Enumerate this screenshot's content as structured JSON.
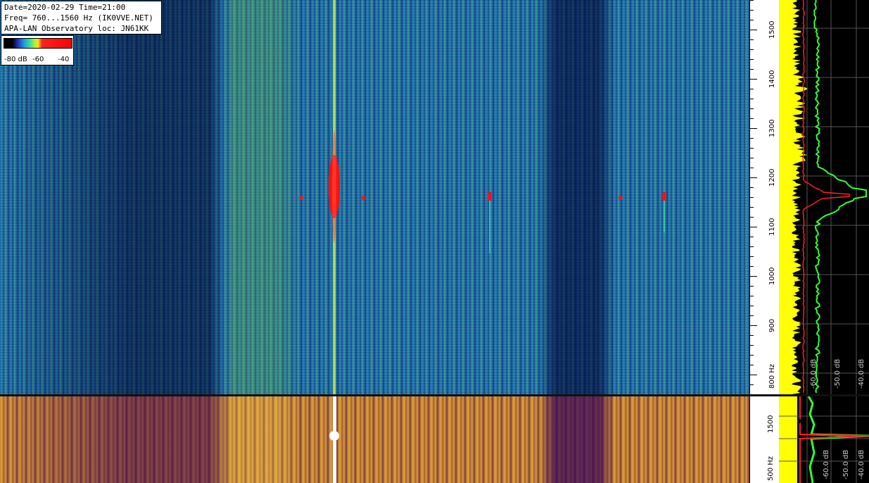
{
  "header": {
    "date_line": "Date=2020-02-29 Time=21:00",
    "freq_line": "Freq= 760...1560 Hz (IK0VVE.NET)",
    "observatory_line": "APA-LAN Observatory loc: JN61KK"
  },
  "legend": {
    "ticks": [
      "-80 dB",
      "-60",
      "-40"
    ]
  },
  "frequency_axis_top": {
    "ticks": [
      {
        "label": "1500",
        "value": 1500
      },
      {
        "label": "1400",
        "value": 1400
      },
      {
        "label": "1300",
        "value": 1300
      },
      {
        "label": "1200",
        "value": 1200
      },
      {
        "label": "1100",
        "value": 1100
      },
      {
        "label": "1000",
        "value": 1000
      },
      {
        "label": "900",
        "value": 900
      },
      {
        "label": "800 Hz",
        "value": 800
      }
    ],
    "min": 760,
    "max": 1560
  },
  "frequency_axis_bottom": {
    "ticks": [
      {
        "label": "1500",
        "value": 1500
      },
      {
        "label": "500 Hz",
        "value": 500
      }
    ]
  },
  "spectrum_top": {
    "db_labels": [
      "-60.0 dB",
      "-50.0 dB",
      "-40.0 dB"
    ]
  },
  "spectrum_bottom": {
    "db_labels": [
      "-60.0 dB",
      "-50.0 dB",
      "-40.0 dB"
    ]
  },
  "colors": {
    "peak": "#ff0000",
    "spectrum_avg": "#ffff00",
    "spectrum_peak": "#33ff33",
    "spectrum_trace": "#ff2020"
  }
}
